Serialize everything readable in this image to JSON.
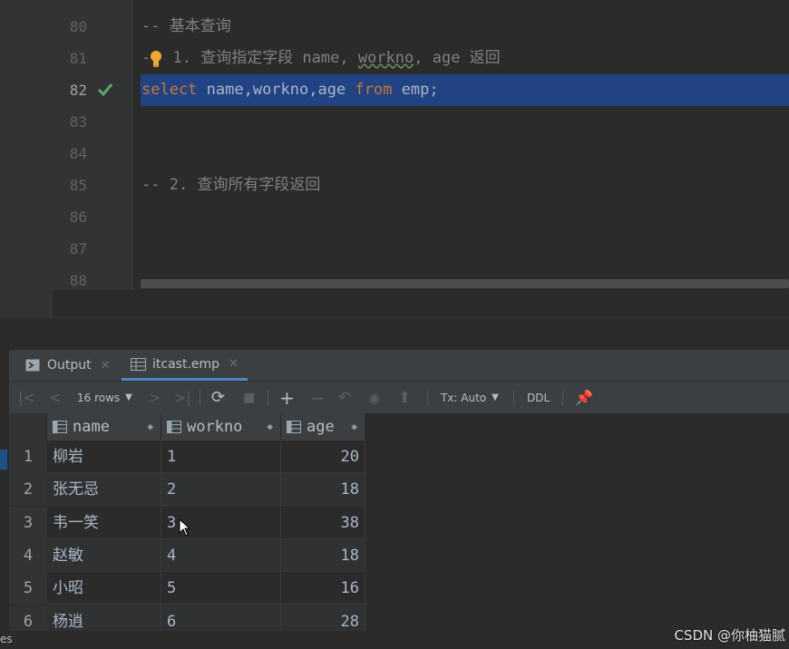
{
  "editor": {
    "lines": [
      {
        "num": "80",
        "text": "-- 基本查询"
      },
      {
        "num": "81",
        "text": "-- 1. 查询指定字段 name, workno, age 返回"
      },
      {
        "num": "82",
        "sql_kw1": "select",
        "sql_cols_a": " name,",
        "sql_cols_b": "workno",
        "sql_cols_c": ",age ",
        "sql_kw2": "from",
        "sql_table": " emp;"
      },
      {
        "num": "83",
        "text": ""
      },
      {
        "num": "84",
        "text": ""
      },
      {
        "num": "85",
        "text": "-- 2. 查询所有字段返回"
      },
      {
        "num": "86",
        "text": ""
      },
      {
        "num": "87",
        "text": ""
      },
      {
        "num": "88",
        "text": ""
      }
    ],
    "comment81_prefix": "-",
    "comment81_rest": " 1. 查询指定字段 name, ",
    "comment81_workno": "workno",
    "comment81_tail": ", age 返回",
    "colors": {
      "keyword": "#cc7832",
      "comment": "#808080",
      "selection": "#214283",
      "check": "#59a869"
    }
  },
  "tabs": [
    {
      "label": "Output",
      "icon": "console-icon"
    },
    {
      "label": "itcast.emp",
      "icon": "table-icon"
    }
  ],
  "toolbar": {
    "rows_label": "16 rows",
    "tx_label": "Tx: Auto",
    "ddl_label": "DDL"
  },
  "grid": {
    "columns": [
      "name",
      "workno",
      "age"
    ],
    "rows": [
      {
        "n": "1",
        "name": "柳岩",
        "workno": "1",
        "age": "20"
      },
      {
        "n": "2",
        "name": "张无忌",
        "workno": "2",
        "age": "18"
      },
      {
        "n": "3",
        "name": "韦一笑",
        "workno": "3",
        "age": "38"
      },
      {
        "n": "4",
        "name": "赵敏",
        "workno": "4",
        "age": "18"
      },
      {
        "n": "5",
        "name": "小昭",
        "workno": "5",
        "age": "16"
      },
      {
        "n": "6",
        "name": "杨逍",
        "workno": "6",
        "age": "28"
      }
    ]
  },
  "watermark": "CSDN @你柚猫腻",
  "footer_fragment": "es"
}
